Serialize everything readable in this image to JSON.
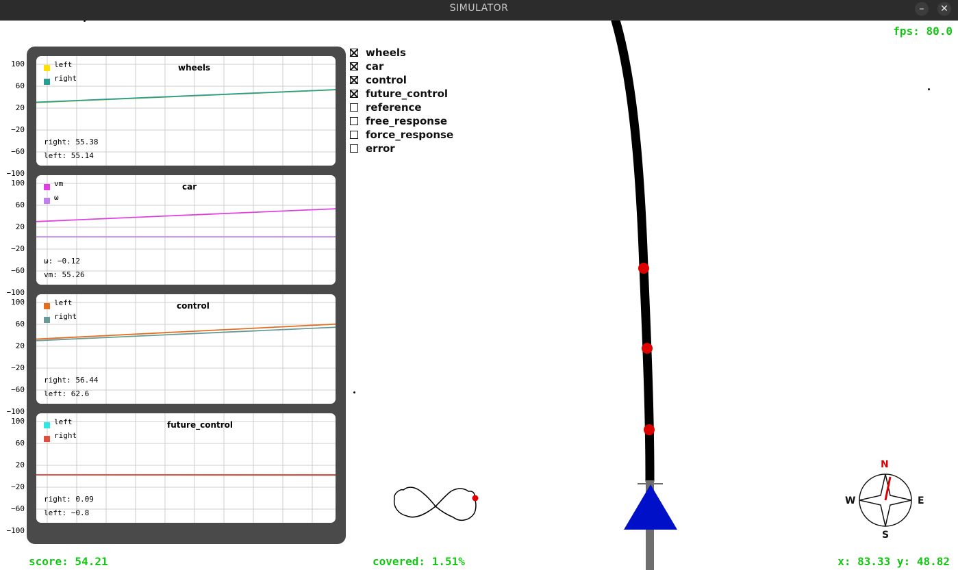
{
  "window": {
    "title": "SIMULATOR",
    "minimize_glyph": "–",
    "close_glyph": "✕"
  },
  "hud": {
    "fps": "fps: 80.0",
    "score": "score: 54.21",
    "covered": "covered: 1.51%",
    "coords": "x: 83.33 y: 48.82"
  },
  "colors": {
    "hud": "#13c613",
    "track": "#000000",
    "waypoint": "#dd0000",
    "car": "#0010c8",
    "panel": "#4a4a4a",
    "compass_needle": "#dd0000"
  },
  "charts": [
    {
      "title": "wheels",
      "yticks": [
        "100",
        "60",
        "20",
        "−20",
        "−60",
        "−100"
      ],
      "ylim": [
        -100,
        100
      ],
      "legend": [
        {
          "label": "left",
          "color": "#ffe000"
        },
        {
          "label": "right",
          "color": "#2a9e92"
        }
      ],
      "readouts": [
        "right: 55.38",
        "left: 55.14"
      ],
      "series": [
        {
          "color": "#c8c800",
          "start": 30,
          "end": 55.14
        },
        {
          "color": "#2a9e92",
          "start": 30.5,
          "end": 55.38
        }
      ]
    },
    {
      "title": "car",
      "yticks": [
        "100",
        "60",
        "20",
        "−20",
        "−60",
        "−100"
      ],
      "ylim": [
        -100,
        100
      ],
      "legend": [
        {
          "label": "vm",
          "color": "#e040e0"
        },
        {
          "label": "ω",
          "color": "#c080f0"
        }
      ],
      "readouts": [
        "ω: −0.12",
        "vm: 55.26"
      ],
      "series": [
        {
          "color": "#e040e0",
          "start": 30,
          "end": 55.26
        },
        {
          "color": "#c080f0",
          "start": -0.12,
          "end": -0.12
        }
      ]
    },
    {
      "title": "control",
      "yticks": [
        "100",
        "60",
        "20",
        "−20",
        "−60",
        "−100"
      ],
      "ylim": [
        -100,
        100
      ],
      "legend": [
        {
          "label": "left",
          "color": "#e07020"
        },
        {
          "label": "right",
          "color": "#6a9a98"
        }
      ],
      "readouts": [
        "right: 56.44",
        "left: 62.6"
      ],
      "series": [
        {
          "color": "#e07020",
          "start": 33,
          "end": 62.6
        },
        {
          "color": "#6a9a98",
          "start": 30,
          "end": 56.44
        }
      ]
    },
    {
      "title": "future_control",
      "yticks": [
        "100",
        "60",
        "20",
        "−20",
        "−60",
        "−100"
      ],
      "ylim": [
        -100,
        100
      ],
      "legend": [
        {
          "label": "left",
          "color": "#30e8e0"
        },
        {
          "label": "right",
          "color": "#e05040"
        }
      ],
      "readouts": [
        "right: 0.09",
        "left: −0.8"
      ],
      "series": [
        {
          "color": "#6a9a98",
          "start": 0.09,
          "end": -0.8
        },
        {
          "color": "#e05040",
          "start": 0.09,
          "end": 0.09
        }
      ]
    }
  ],
  "checkboxes": [
    {
      "label": "wheels",
      "checked": true
    },
    {
      "label": "car",
      "checked": true
    },
    {
      "label": "control",
      "checked": true
    },
    {
      "label": "future_control",
      "checked": true
    },
    {
      "label": "reference",
      "checked": false
    },
    {
      "label": "free_response",
      "checked": false
    },
    {
      "label": "force_response",
      "checked": false
    },
    {
      "label": "error",
      "checked": false
    }
  ],
  "compass": {
    "n": "N",
    "e": "E",
    "s": "S",
    "w": "W"
  }
}
